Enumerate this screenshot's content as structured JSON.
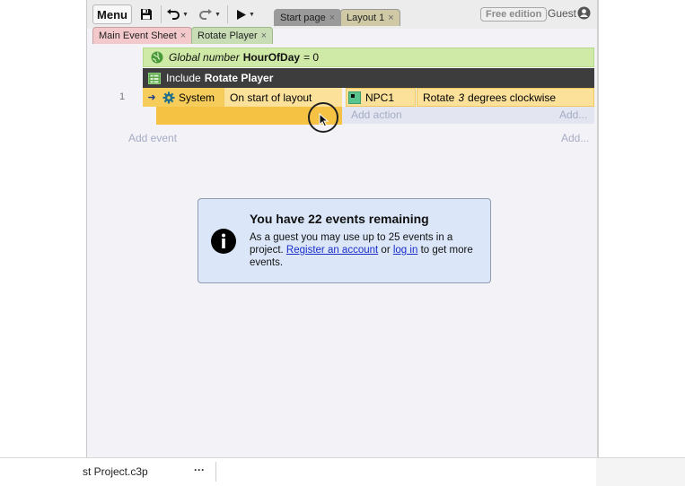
{
  "toolbar": {
    "menu_label": "Menu",
    "top_tabs": [
      {
        "label": "Start page",
        "close": "×"
      },
      {
        "label": "Layout 1",
        "close": "×"
      }
    ],
    "free_edition": "Free edition",
    "guest": "Guest"
  },
  "sheet_tabs": [
    {
      "label": "Main Event Sheet",
      "close": "×"
    },
    {
      "label": "Rotate Player",
      "close": "×"
    }
  ],
  "global_var": {
    "prefix": "Global number",
    "name": "HourOfDay",
    "value": "= 0"
  },
  "include": {
    "prefix": "Include",
    "name": "Rotate Player"
  },
  "event": {
    "number": "1",
    "condition_object": "System",
    "condition_text": "On start of layout",
    "action_object": "NPC1",
    "action_text_before": "Rotate",
    "action_text_value": "3",
    "action_text_after": "degrees clockwise"
  },
  "placeholders": {
    "add_action": "Add action",
    "add_dots": "Add...",
    "add_event": "Add event"
  },
  "dialog": {
    "title": "You have 22 events remaining",
    "body_1": "As a guest you may use up to 25 events in a project.",
    "link_register": "Register an account",
    "body_or": "or",
    "link_login": "log in",
    "body_2": "to get more events."
  },
  "statusbar": {
    "project": "st Project.c3p",
    "dots": "···"
  },
  "colors": {
    "global_row": "#cfe9a6",
    "include_row": "#3d3d3d",
    "condition": "#f6cd5a",
    "action": "#fbe19a",
    "dialog_bg": "#dbe7f9",
    "link": "#1a2dcc"
  }
}
